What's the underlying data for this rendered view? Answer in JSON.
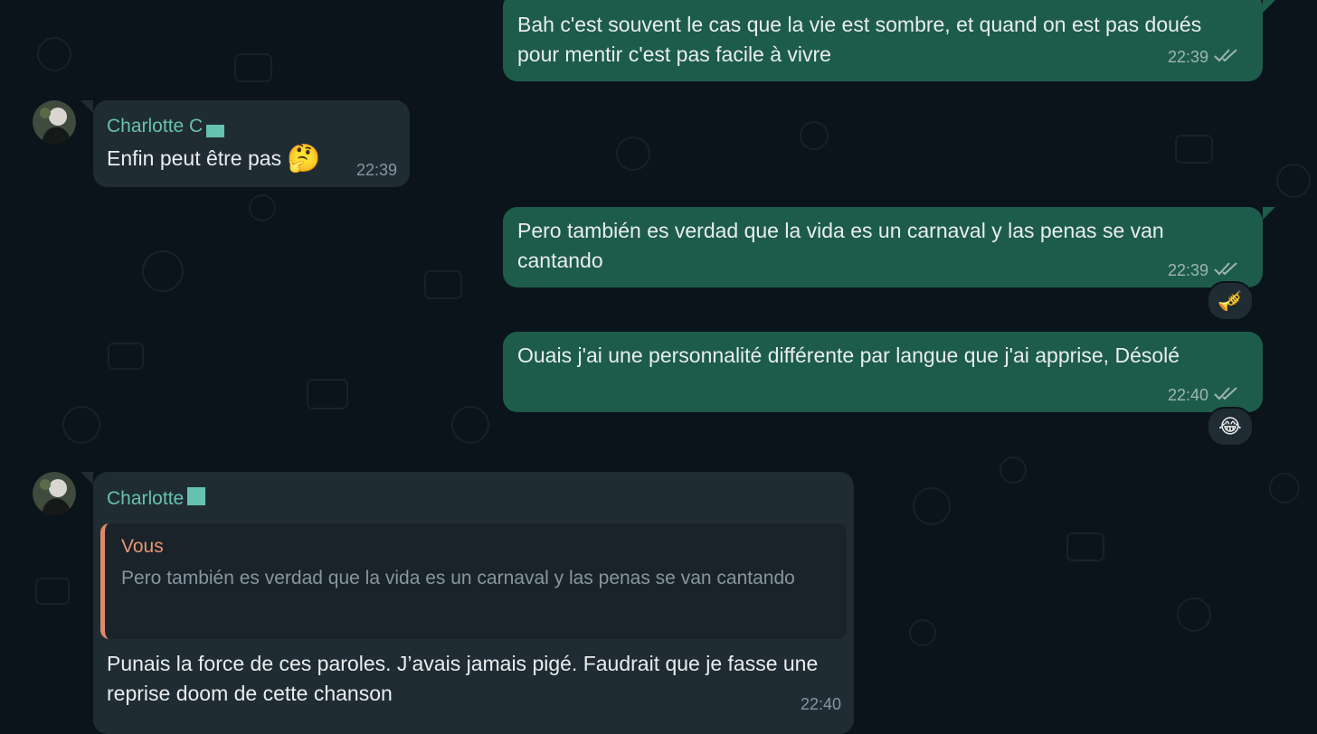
{
  "messages": [
    {
      "direction": "outgoing",
      "text": "Bah c'est souvent le cas que la vie est sombre, et quand on est pas doués pour mentir c'est pas facile à vivre",
      "time": "22:39",
      "status_icon": "double-check-icon"
    },
    {
      "direction": "incoming",
      "sender": "Charlotte C",
      "text": "Enfin peut être pas",
      "emoji": "🤔",
      "time": "22:39"
    },
    {
      "direction": "outgoing",
      "text": "Pero también es verdad que la vida es un carnaval y las penas se van cantando",
      "time": "22:39",
      "status_icon": "double-check-icon",
      "reaction": "🎺"
    },
    {
      "direction": "outgoing",
      "text": "Ouais j'ai une personnalité différente par langue que j'ai apprise, Désolé",
      "time": "22:40",
      "status_icon": "double-check-icon",
      "reaction": "😂"
    },
    {
      "direction": "incoming",
      "sender": "Charlotte",
      "quote": {
        "author": "Vous",
        "text": "Pero también es verdad que la vida es un carnaval y las penas se van cantando"
      },
      "text": "Punais la force de ces paroles. J’avais jamais pigé. Faudrait que je fasse une reprise doom de cette chanson",
      "time": "22:40"
    }
  ],
  "colors": {
    "background": "#0b141a",
    "outgoing_bubble": "#1d5c4b",
    "incoming_bubble": "#202c33",
    "sender_name": "#66c2b0",
    "quote_author": "#e7956f"
  }
}
